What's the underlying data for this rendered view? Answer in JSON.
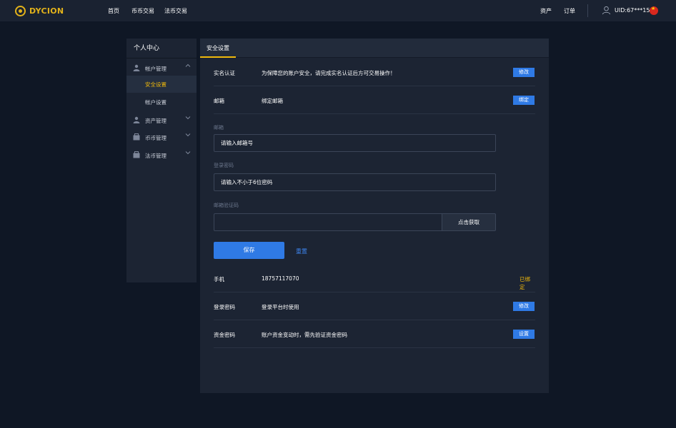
{
  "header": {
    "brand": "DYCION",
    "nav": [
      "首页",
      "币币交易",
      "法币交易"
    ],
    "right_nav": [
      "资产",
      "订单"
    ],
    "uid": "UID:67***15",
    "flag_icon": "china-flag-icon",
    "colors": {
      "brand": "#e2b21a",
      "accent": "#f0b90b",
      "primary": "#2f7ae5"
    }
  },
  "sidebar": {
    "title": "个人中心",
    "groups": [
      {
        "label": "帐户管理",
        "icon": "user-icon",
        "expanded": true,
        "items": [
          {
            "label": "安全设置",
            "active": true
          },
          {
            "label": "帐户设置",
            "active": false
          }
        ]
      },
      {
        "label": "资产管理",
        "icon": "asset-icon",
        "expanded": false
      },
      {
        "label": "币币管理",
        "icon": "wallet-icon",
        "expanded": false
      },
      {
        "label": "法币管理",
        "icon": "bank-icon",
        "expanded": false
      }
    ]
  },
  "main": {
    "tab": "安全设置",
    "rows": {
      "realname": {
        "key": "实名认证",
        "value": "为保障您的账户安全，请完成实名认证后方可交易操作！",
        "action": "修改"
      },
      "email": {
        "key": "邮箱",
        "value": "绑定邮箱",
        "action": "绑定"
      },
      "phone": {
        "key": "手机",
        "value": "18757117070",
        "status": "已绑定"
      },
      "login_password": {
        "key": "登录密码",
        "value": "登录平台时使用",
        "action": "修改"
      },
      "fund_password": {
        "key": "资金密码",
        "value": "账户资金变动时，需先验证资金密码",
        "action": "设置"
      }
    },
    "form": {
      "email_label": "邮箱",
      "email_placeholder": "请输入邮箱号",
      "password_label": "登录密码",
      "password_placeholder": "请输入不小于6位密码",
      "code_label": "邮箱验证码",
      "code_value": "",
      "get_code": "点击获取",
      "save": "保存",
      "reset": "重置"
    }
  }
}
